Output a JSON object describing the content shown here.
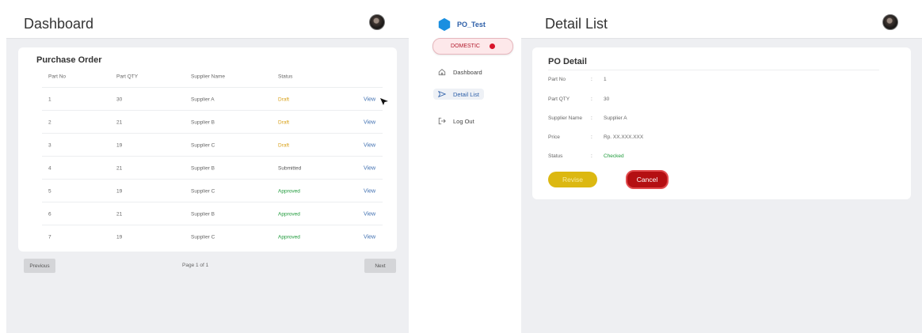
{
  "left": {
    "page_title": "Dashboard",
    "card_title": "Purchase Order",
    "columns": [
      "Part No",
      "Part QTY",
      "Supplier Name",
      "Status"
    ],
    "rows": [
      {
        "part_no": "1",
        "qty": "30",
        "supplier": "Supplier A",
        "status": "Draft",
        "status_color": "#d9a21b",
        "action": "View"
      },
      {
        "part_no": "2",
        "qty": "21",
        "supplier": "Supplier B",
        "status": "Draft",
        "status_color": "#d9a21b",
        "action": "View"
      },
      {
        "part_no": "3",
        "qty": "19",
        "supplier": "Supplier C",
        "status": "Draft",
        "status_color": "#d9a21b",
        "action": "View"
      },
      {
        "part_no": "4",
        "qty": "21",
        "supplier": "Supplier B",
        "status": "Submitted",
        "status_color": "#555555",
        "action": "View"
      },
      {
        "part_no": "5",
        "qty": "19",
        "supplier": "Supplier C",
        "status": "Approved",
        "status_color": "#1e9a3a",
        "action": "View"
      },
      {
        "part_no": "6",
        "qty": "21",
        "supplier": "Supplier B",
        "status": "Approved",
        "status_color": "#1e9a3a",
        "action": "View"
      },
      {
        "part_no": "7",
        "qty": "19",
        "supplier": "Supplier C",
        "status": "Approved",
        "status_color": "#1e9a3a",
        "action": "View"
      }
    ],
    "pagination": {
      "previous": "Previous",
      "page_info": "Page 1 of 1",
      "next": "Next"
    }
  },
  "sidebar": {
    "app_name": "PO_Test",
    "region_pill": "DOMESTIC",
    "nav": [
      {
        "label": "Dashboard",
        "icon": "home-icon"
      },
      {
        "label": "Detail List",
        "icon": "send-icon",
        "active": true
      },
      {
        "label": "Log Out",
        "icon": "logout-icon"
      }
    ]
  },
  "main": {
    "page_title": "Detail List",
    "card_title": "PO Detail",
    "fields": [
      {
        "key": "Part No",
        "value": "1"
      },
      {
        "key": "Part QTY",
        "value": "30"
      },
      {
        "key": "Supplier Name",
        "value": "Supplier A"
      },
      {
        "key": "Price",
        "value": "Rp. XX.XXX.XXX"
      },
      {
        "key": "Status",
        "value": "Checked"
      }
    ],
    "colon": ":",
    "revise_label": "Revise",
    "cancel_label": "Cancel"
  },
  "colors": {
    "accent": "#2d5fa8",
    "revise": "#dcb811",
    "cancel": "#b40f12",
    "domestic": "#d8152b"
  }
}
